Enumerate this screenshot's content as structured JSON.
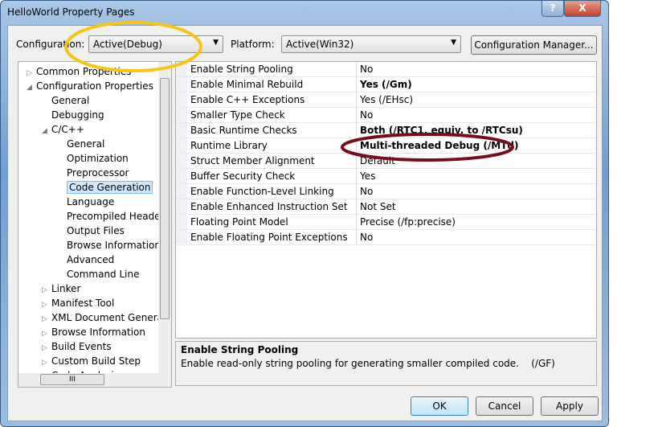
{
  "window": {
    "title": "HelloWorld Property Pages",
    "help": "?",
    "close": "X"
  },
  "toolbar": {
    "config_label": "Configuration:",
    "config_value": "Active(Debug)",
    "platform_label": "Platform:",
    "platform_value": "Active(Win32)",
    "config_manager": "Configuration Manager..."
  },
  "tree": [
    {
      "label": "Common Properties",
      "level": 0,
      "toggle": "▷"
    },
    {
      "label": "Configuration Properties",
      "level": 0,
      "toggle": "◢"
    },
    {
      "label": "General",
      "level": 1,
      "toggle": ""
    },
    {
      "label": "Debugging",
      "level": 1,
      "toggle": ""
    },
    {
      "label": "C/C++",
      "level": 1,
      "toggle": "◢"
    },
    {
      "label": "General",
      "level": 2,
      "toggle": ""
    },
    {
      "label": "Optimization",
      "level": 2,
      "toggle": ""
    },
    {
      "label": "Preprocessor",
      "level": 2,
      "toggle": ""
    },
    {
      "label": "Code Generation",
      "level": 2,
      "toggle": "",
      "selected": true
    },
    {
      "label": "Language",
      "level": 2,
      "toggle": ""
    },
    {
      "label": "Precompiled Heade",
      "level": 2,
      "toggle": ""
    },
    {
      "label": "Output Files",
      "level": 2,
      "toggle": ""
    },
    {
      "label": "Browse Information",
      "level": 2,
      "toggle": ""
    },
    {
      "label": "Advanced",
      "level": 2,
      "toggle": ""
    },
    {
      "label": "Command Line",
      "level": 2,
      "toggle": ""
    },
    {
      "label": "Linker",
      "level": 1,
      "toggle": "▷"
    },
    {
      "label": "Manifest Tool",
      "level": 1,
      "toggle": "▷"
    },
    {
      "label": "XML Document Genera",
      "level": 1,
      "toggle": "▷"
    },
    {
      "label": "Browse Information",
      "level": 1,
      "toggle": "▷"
    },
    {
      "label": "Build Events",
      "level": 1,
      "toggle": "▷"
    },
    {
      "label": "Custom Build Step",
      "level": 1,
      "toggle": "▷"
    },
    {
      "label": "Code Analysis",
      "level": 1,
      "toggle": "▷"
    }
  ],
  "properties": [
    {
      "name": "Enable String Pooling",
      "value": "No"
    },
    {
      "name": "Enable Minimal Rebuild",
      "value": "Yes (/Gm)",
      "bold": true
    },
    {
      "name": "Enable C++ Exceptions",
      "value": "Yes (/EHsc)"
    },
    {
      "name": "Smaller Type Check",
      "value": "No"
    },
    {
      "name": "Basic Runtime Checks",
      "value": "Both (/RTC1, equiv. to /RTCsu)",
      "bold": true
    },
    {
      "name": "Runtime Library",
      "value": "Multi-threaded Debug (/MTd)",
      "bold": true
    },
    {
      "name": "Struct Member Alignment",
      "value": "Default"
    },
    {
      "name": "Buffer Security Check",
      "value": "Yes"
    },
    {
      "name": "Enable Function-Level Linking",
      "value": "No"
    },
    {
      "name": "Enable Enhanced Instruction Set",
      "value": "Not Set"
    },
    {
      "name": "Floating Point Model",
      "value": "Precise (/fp:precise)"
    },
    {
      "name": "Enable Floating Point Exceptions",
      "value": "No"
    }
  ],
  "description": {
    "title": "Enable String Pooling",
    "text": "Enable read-only string pooling for generating smaller compiled code.",
    "switch": "(/GF)"
  },
  "buttons": {
    "ok": "OK",
    "cancel": "Cancel",
    "apply": "Apply"
  },
  "colors": {
    "highlight_yellow": "#f5c518",
    "highlight_red": "#7a0a1e"
  }
}
